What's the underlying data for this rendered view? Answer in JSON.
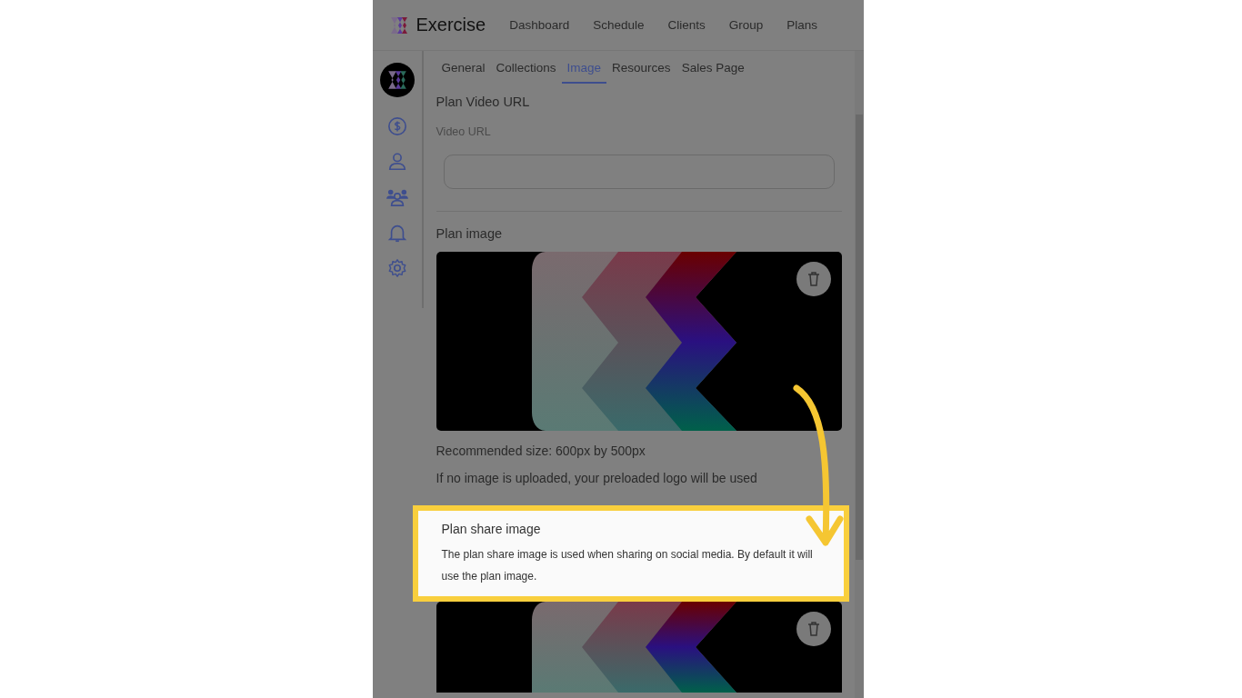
{
  "app": {
    "name": "Exercise"
  },
  "nav": [
    {
      "label": "Dashboard"
    },
    {
      "label": "Schedule"
    },
    {
      "label": "Clients"
    },
    {
      "label": "Group"
    },
    {
      "label": "Plans"
    }
  ],
  "tabs": [
    {
      "label": "General",
      "selected": false
    },
    {
      "label": "Collections",
      "selected": false
    },
    {
      "label": "Image",
      "selected": true
    },
    {
      "label": "Resources",
      "selected": false
    },
    {
      "label": "Sales Page",
      "selected": false
    }
  ],
  "video": {
    "title": "Plan Video URL",
    "label": "Video URL"
  },
  "plan_image": {
    "title": "Plan image",
    "notes": [
      "Recommended size: 600px by 500px",
      "If no image is uploaded, your preloaded logo will be used"
    ]
  },
  "plan_share_image": {
    "title": "Plan share image",
    "description": "The plan share image is used when sharing on social media. By default it will use the plan image.",
    "highlighted": true
  }
}
